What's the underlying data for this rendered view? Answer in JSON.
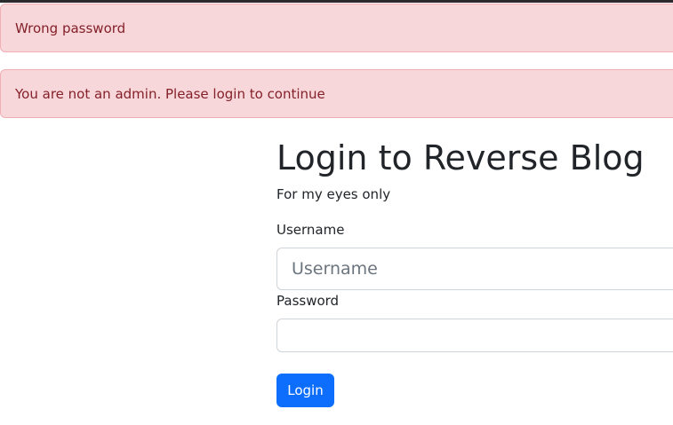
{
  "alerts": [
    {
      "text": "Wrong password"
    },
    {
      "text": "You are not an admin. Please login to continue"
    }
  ],
  "login": {
    "title": "Login to Reverse Blog",
    "subtitle": "For my eyes only",
    "username_label": "Username",
    "username_placeholder": "Username",
    "username_value": "",
    "password_label": "Password",
    "password_value": "",
    "submit_label": "Login"
  },
  "colors": {
    "alert_background": "#f8d7da",
    "alert_text": "#842029",
    "primary_button": "#0d6efd"
  }
}
